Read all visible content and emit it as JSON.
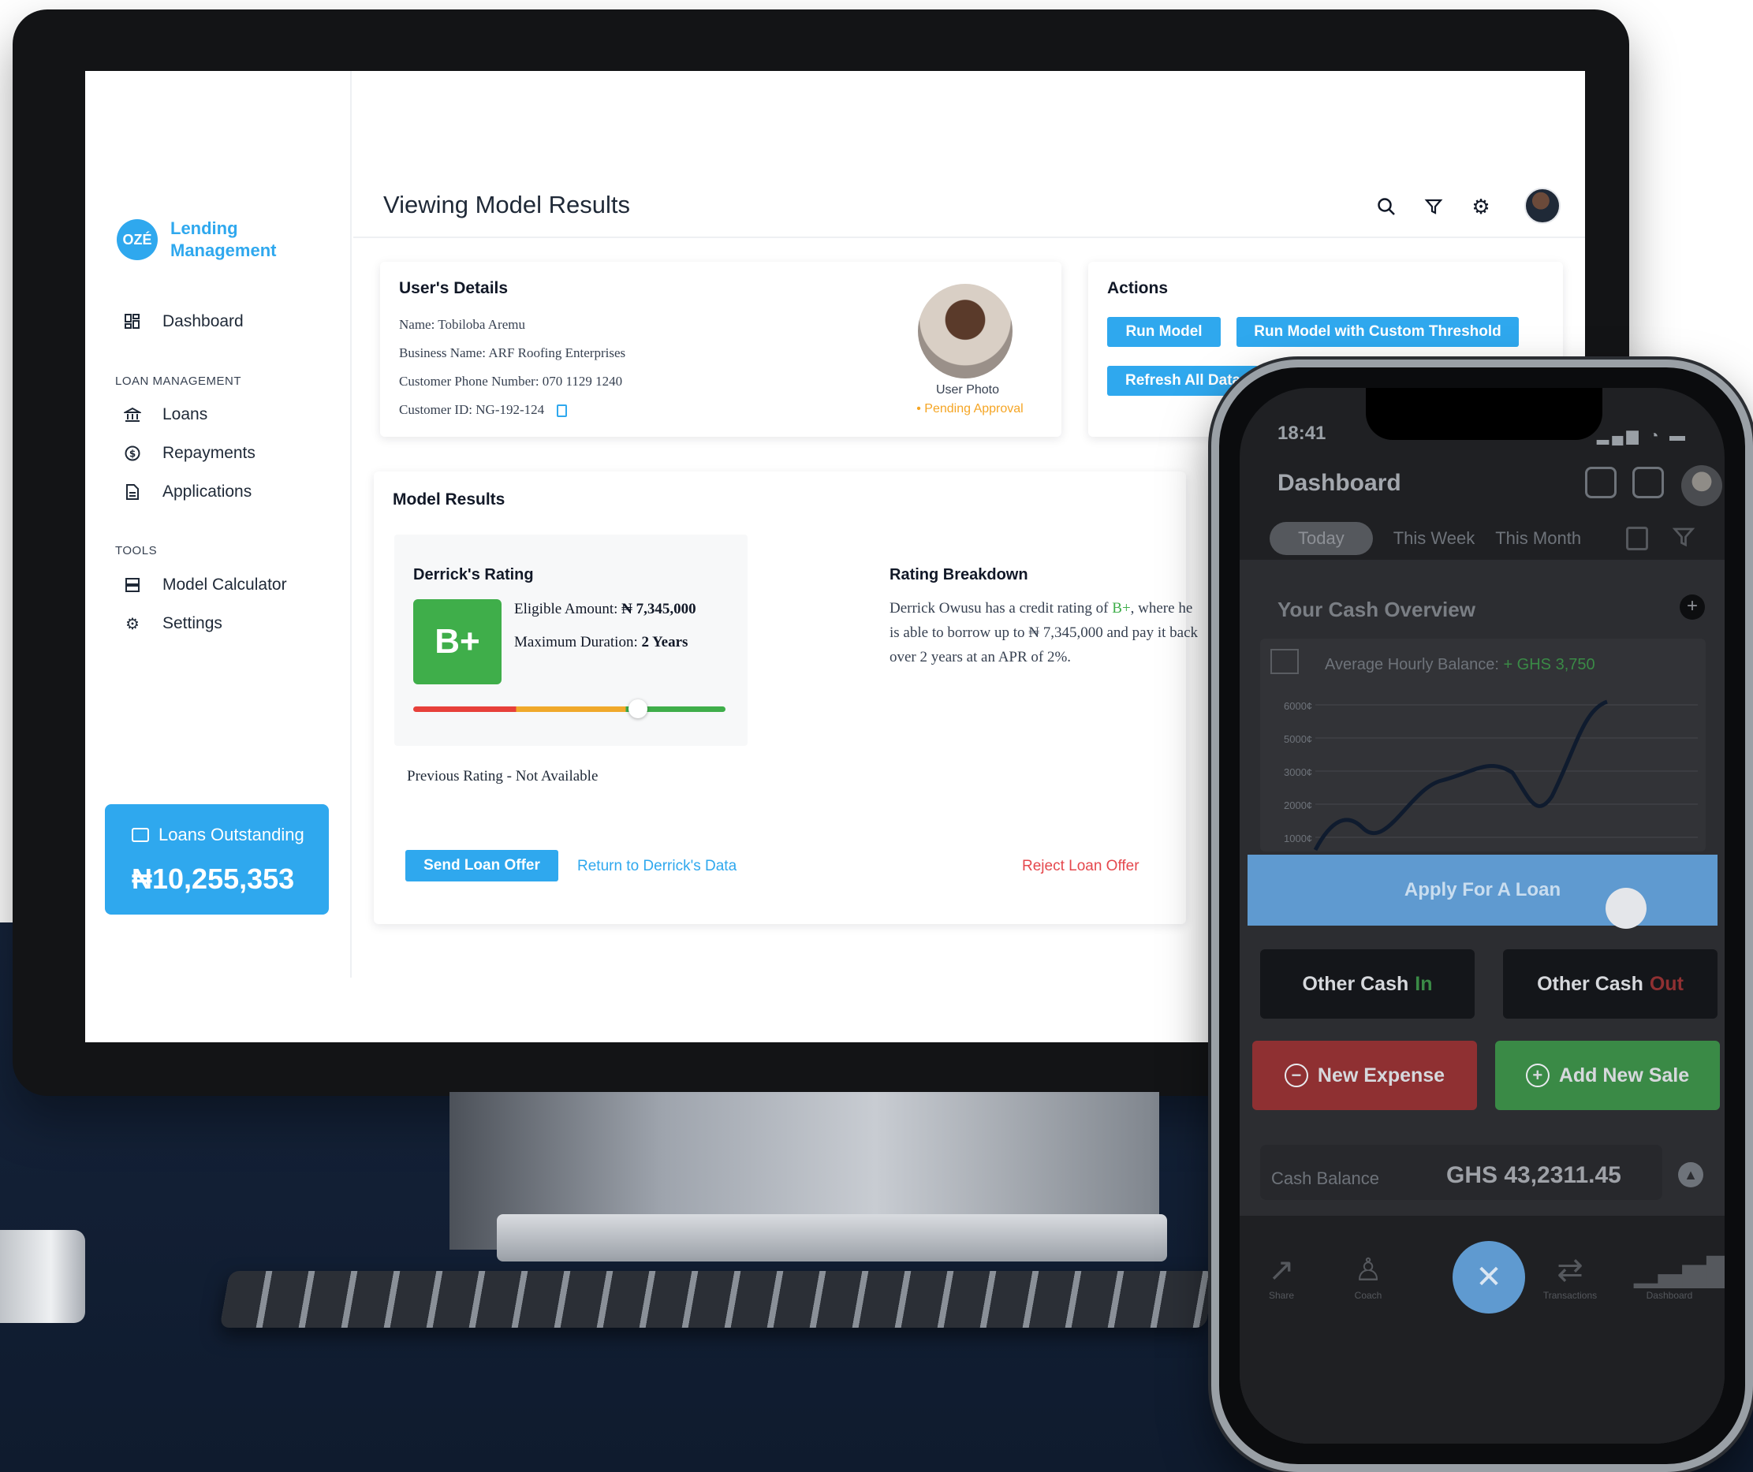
{
  "sidebar": {
    "brand_logo": "OZÉ",
    "brand_name": "Lending Management",
    "dashboard": "Dashboard",
    "section_loan_management": "LOAN MANAGEMENT",
    "loans": "Loans",
    "repayments": "Repayments",
    "applications": "Applications",
    "section_tools": "TOOLS",
    "model_calculator": "Model Calculator",
    "settings": "Settings",
    "loans_outstanding_label": "Loans Outstanding",
    "loans_outstanding_value": "₦10,255,353"
  },
  "header": {
    "title": "Viewing Model Results"
  },
  "user_details": {
    "title": "User's Details",
    "name": "Name: Tobiloba Aremu",
    "business_name": "Business Name: ARF Roofing Enterprises",
    "phone": "Customer Phone Number: 070 1129 1240",
    "customer_id": "Customer ID: NG-192-124",
    "photo_label": "User Photo",
    "status": "• Pending Approval"
  },
  "actions": {
    "title": "Actions",
    "run_model": "Run Model",
    "run_custom": "Run Model with Custom Threshold",
    "refresh": "Refresh All Data"
  },
  "model_results": {
    "title": "Model Results",
    "rating_title": "Derrick's Rating",
    "grade": "B+",
    "eligible_label": "Eligible Amount:",
    "eligible_value": "₦ 7,345,000",
    "duration_label": "Maximum Duration:",
    "duration_value": "2 Years",
    "rating_position": 0.72,
    "previous_rating": "Previous Rating - Not Available",
    "breakdown_title": "Rating Breakdown",
    "breakdown_prefix": "Derrick Owusu has a credit rating of ",
    "breakdown_grade": "B+",
    "breakdown_suffix": ", where he is able to borrow up to ₦ 7,345,000 and pay it back over 2 years at an APR of 2%.",
    "send_offer": "Send Loan Offer",
    "return_link": "Return to Derrick's Data",
    "reject_link": "Reject Loan Offer"
  },
  "phone": {
    "time": "18:41",
    "title": "Dashboard",
    "tabs": [
      "Today",
      "This Week",
      "This Month"
    ],
    "overview_title": "Your Cash Overview",
    "avg_label": "Average Hourly Balance:",
    "avg_value": "+ GHS 3,750",
    "y_ticks": [
      "6000¢",
      "5000¢",
      "3000¢",
      "2000¢",
      "1000¢"
    ],
    "apply_loan": "Apply For A Loan",
    "other_cash_in_prefix": "Other Cash",
    "other_cash_in_suffix": "In",
    "other_cash_out_prefix": "Other Cash",
    "other_cash_out_suffix": "Out",
    "new_expense": "New Expense",
    "add_new_sale": "Add New Sale",
    "cash_balance_label": "Cash Balance",
    "cash_balance_value": "GHS 43,2311.45",
    "nav": [
      "Share",
      "Coach",
      "Transactions",
      "Dashboard"
    ]
  },
  "colors": {
    "accent": "#2fa8ee",
    "grade_green": "#3fae4a",
    "pending_orange": "#f5a524",
    "reject_red": "#e5484d"
  }
}
